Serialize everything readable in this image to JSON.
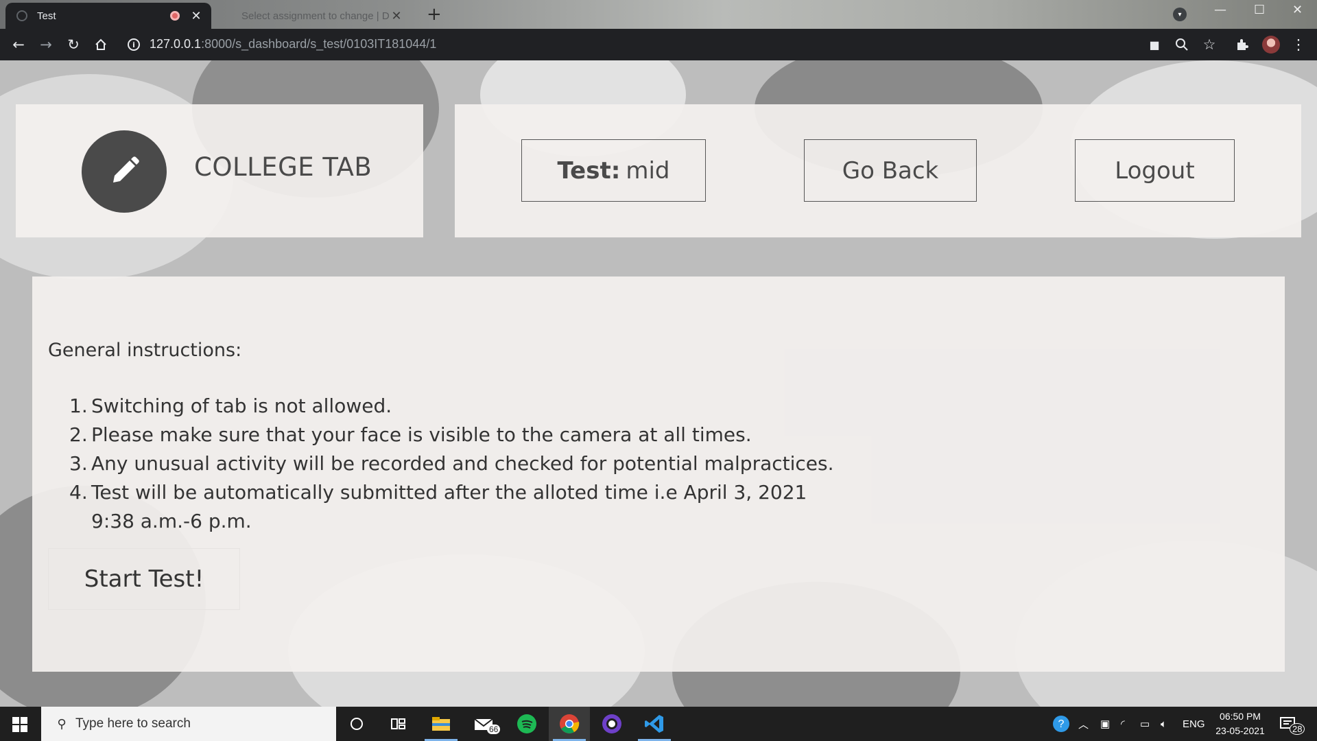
{
  "browser": {
    "tabs": [
      {
        "title": "Test",
        "active": true
      },
      {
        "title": "Select assignment to change | D",
        "active": false
      }
    ],
    "url_host": "127.0.0.1",
    "url_path": ":8000/s_dashboard/s_test/0103IT181044/1",
    "icons": [
      "back-icon",
      "forward-icon",
      "reload-icon",
      "home-icon",
      "camera-icon",
      "zoom-icon",
      "star-icon",
      "extensions-icon",
      "menu-icon"
    ]
  },
  "header": {
    "brand": "COLLEGE TAB",
    "test_label": "Test:",
    "test_name": "mid",
    "go_back": "Go Back",
    "logout": "Logout"
  },
  "main": {
    "title": "General instructions:",
    "instructions": [
      {
        "num": "1.",
        "text": "Switching of tab is not allowed."
      },
      {
        "num": "2.",
        "text": "Please make sure that your face is visible to the camera at all times."
      },
      {
        "num": "3.",
        "text": "Any unusual activity will be recorded and checked for potential malpractices."
      },
      {
        "num": "4.",
        "text": "Test will be automatically submitted after the alloted time i.e April 3, 2021 9:38 a.m.-6 p.m."
      }
    ],
    "start_button": "Start Test!"
  },
  "taskbar": {
    "search_placeholder": "Type here to search",
    "mail_badge": "66",
    "language": "ENG",
    "time": "06:50 PM",
    "date": "23-05-2021",
    "notifications": "28"
  },
  "colors": {
    "panel": "#f3f0ee",
    "accent_dark": "#4a4a4a",
    "browser_dark": "#202124",
    "taskbar": "#1f1f1f"
  }
}
